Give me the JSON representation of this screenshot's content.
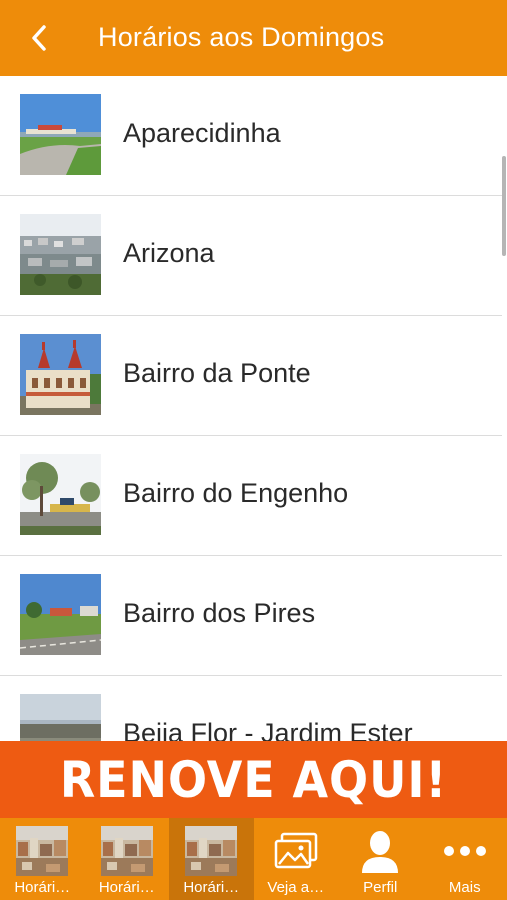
{
  "header": {
    "title": "Horários aos Domingos",
    "back_icon": "chevron-left-icon"
  },
  "list": {
    "items": [
      {
        "label": "Aparecidinha"
      },
      {
        "label": "Arizona"
      },
      {
        "label": "Bairro da Ponte"
      },
      {
        "label": "Bairro do Engenho"
      },
      {
        "label": "Bairro dos Pires"
      },
      {
        "label": "Beija Flor - Jardim Ester"
      }
    ]
  },
  "banner": {
    "text": "RENOVE AQUI!"
  },
  "tabbar": {
    "tabs": [
      {
        "label": "Horári…",
        "icon": "city-photo-icon",
        "active": false
      },
      {
        "label": "Horári…",
        "icon": "city-photo-icon",
        "active": false
      },
      {
        "label": "Horári…",
        "icon": "city-photo-icon",
        "active": true
      },
      {
        "label": "Veja a…",
        "icon": "gallery-icon",
        "active": false
      },
      {
        "label": "Perfil",
        "icon": "user-icon",
        "active": false
      },
      {
        "label": "Mais",
        "icon": "more-icon",
        "active": false
      }
    ]
  },
  "colors": {
    "primary": "#ee8c0a",
    "banner": "#ee5b12",
    "active_tab": "#c9740a"
  }
}
